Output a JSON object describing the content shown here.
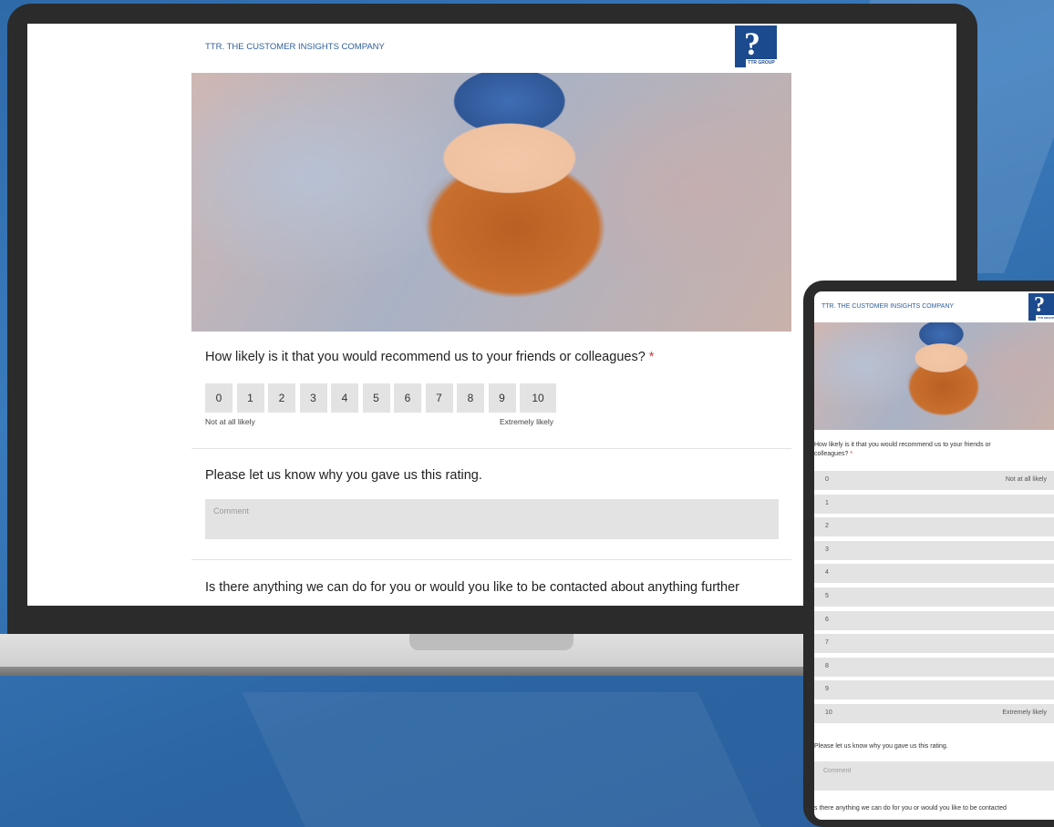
{
  "survey": {
    "company": "TTR. THE CUSTOMER INSIGHTS COMPANY",
    "logo_text": "TTR GROUP",
    "q1": "How likely is it that you would recommend us to your friends or colleagues?",
    "required_mark": "*",
    "scale": [
      "0",
      "1",
      "2",
      "3",
      "4",
      "5",
      "6",
      "7",
      "8",
      "9",
      "10"
    ],
    "low_label": "Not at all likely",
    "high_label": "Extremely likely",
    "q2": "Please let us know why you gave us this rating.",
    "comment_placeholder": "Comment",
    "q3": "Is there anything we can do for you or would you like to be contacted about anything further",
    "q3_mobile": "s there anything we can do for you or would you like to be contacted"
  },
  "mobile": {
    "q1_line1": "How likely is it that you would recommend us to your friends or",
    "q1_line2": "colleagues?",
    "q2": "Please let us know why you gave us this rating."
  },
  "colors": {
    "brand": "#1c4a8e",
    "background": "#2f6aa8",
    "button_bg": "#e3e3e3",
    "required": "#d33333"
  }
}
